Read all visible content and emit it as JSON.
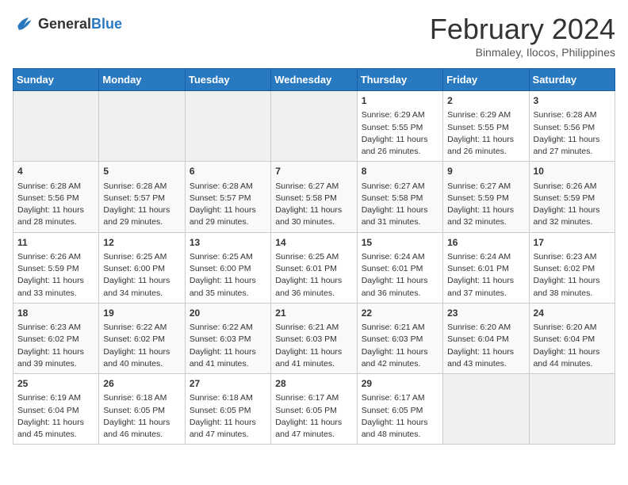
{
  "header": {
    "logo_general": "General",
    "logo_blue": "Blue",
    "month_year": "February 2024",
    "location": "Binmaley, Ilocos, Philippines"
  },
  "days_of_week": [
    "Sunday",
    "Monday",
    "Tuesday",
    "Wednesday",
    "Thursday",
    "Friday",
    "Saturday"
  ],
  "weeks": [
    [
      {
        "day": "",
        "info": "",
        "empty": true
      },
      {
        "day": "",
        "info": "",
        "empty": true
      },
      {
        "day": "",
        "info": "",
        "empty": true
      },
      {
        "day": "",
        "info": "",
        "empty": true
      },
      {
        "day": "1",
        "info": "Sunrise: 6:29 AM\nSunset: 5:55 PM\nDaylight: 11 hours and 26 minutes."
      },
      {
        "day": "2",
        "info": "Sunrise: 6:29 AM\nSunset: 5:55 PM\nDaylight: 11 hours and 26 minutes."
      },
      {
        "day": "3",
        "info": "Sunrise: 6:28 AM\nSunset: 5:56 PM\nDaylight: 11 hours and 27 minutes."
      }
    ],
    [
      {
        "day": "4",
        "info": "Sunrise: 6:28 AM\nSunset: 5:56 PM\nDaylight: 11 hours and 28 minutes."
      },
      {
        "day": "5",
        "info": "Sunrise: 6:28 AM\nSunset: 5:57 PM\nDaylight: 11 hours and 29 minutes."
      },
      {
        "day": "6",
        "info": "Sunrise: 6:28 AM\nSunset: 5:57 PM\nDaylight: 11 hours and 29 minutes."
      },
      {
        "day": "7",
        "info": "Sunrise: 6:27 AM\nSunset: 5:58 PM\nDaylight: 11 hours and 30 minutes."
      },
      {
        "day": "8",
        "info": "Sunrise: 6:27 AM\nSunset: 5:58 PM\nDaylight: 11 hours and 31 minutes."
      },
      {
        "day": "9",
        "info": "Sunrise: 6:27 AM\nSunset: 5:59 PM\nDaylight: 11 hours and 32 minutes."
      },
      {
        "day": "10",
        "info": "Sunrise: 6:26 AM\nSunset: 5:59 PM\nDaylight: 11 hours and 32 minutes."
      }
    ],
    [
      {
        "day": "11",
        "info": "Sunrise: 6:26 AM\nSunset: 5:59 PM\nDaylight: 11 hours and 33 minutes."
      },
      {
        "day": "12",
        "info": "Sunrise: 6:25 AM\nSunset: 6:00 PM\nDaylight: 11 hours and 34 minutes."
      },
      {
        "day": "13",
        "info": "Sunrise: 6:25 AM\nSunset: 6:00 PM\nDaylight: 11 hours and 35 minutes."
      },
      {
        "day": "14",
        "info": "Sunrise: 6:25 AM\nSunset: 6:01 PM\nDaylight: 11 hours and 36 minutes."
      },
      {
        "day": "15",
        "info": "Sunrise: 6:24 AM\nSunset: 6:01 PM\nDaylight: 11 hours and 36 minutes."
      },
      {
        "day": "16",
        "info": "Sunrise: 6:24 AM\nSunset: 6:01 PM\nDaylight: 11 hours and 37 minutes."
      },
      {
        "day": "17",
        "info": "Sunrise: 6:23 AM\nSunset: 6:02 PM\nDaylight: 11 hours and 38 minutes."
      }
    ],
    [
      {
        "day": "18",
        "info": "Sunrise: 6:23 AM\nSunset: 6:02 PM\nDaylight: 11 hours and 39 minutes."
      },
      {
        "day": "19",
        "info": "Sunrise: 6:22 AM\nSunset: 6:02 PM\nDaylight: 11 hours and 40 minutes."
      },
      {
        "day": "20",
        "info": "Sunrise: 6:22 AM\nSunset: 6:03 PM\nDaylight: 11 hours and 41 minutes."
      },
      {
        "day": "21",
        "info": "Sunrise: 6:21 AM\nSunset: 6:03 PM\nDaylight: 11 hours and 41 minutes."
      },
      {
        "day": "22",
        "info": "Sunrise: 6:21 AM\nSunset: 6:03 PM\nDaylight: 11 hours and 42 minutes."
      },
      {
        "day": "23",
        "info": "Sunrise: 6:20 AM\nSunset: 6:04 PM\nDaylight: 11 hours and 43 minutes."
      },
      {
        "day": "24",
        "info": "Sunrise: 6:20 AM\nSunset: 6:04 PM\nDaylight: 11 hours and 44 minutes."
      }
    ],
    [
      {
        "day": "25",
        "info": "Sunrise: 6:19 AM\nSunset: 6:04 PM\nDaylight: 11 hours and 45 minutes."
      },
      {
        "day": "26",
        "info": "Sunrise: 6:18 AM\nSunset: 6:05 PM\nDaylight: 11 hours and 46 minutes."
      },
      {
        "day": "27",
        "info": "Sunrise: 6:18 AM\nSunset: 6:05 PM\nDaylight: 11 hours and 47 minutes."
      },
      {
        "day": "28",
        "info": "Sunrise: 6:17 AM\nSunset: 6:05 PM\nDaylight: 11 hours and 47 minutes."
      },
      {
        "day": "29",
        "info": "Sunrise: 6:17 AM\nSunset: 6:05 PM\nDaylight: 11 hours and 48 minutes."
      },
      {
        "day": "",
        "info": "",
        "empty": true
      },
      {
        "day": "",
        "info": "",
        "empty": true
      }
    ]
  ]
}
